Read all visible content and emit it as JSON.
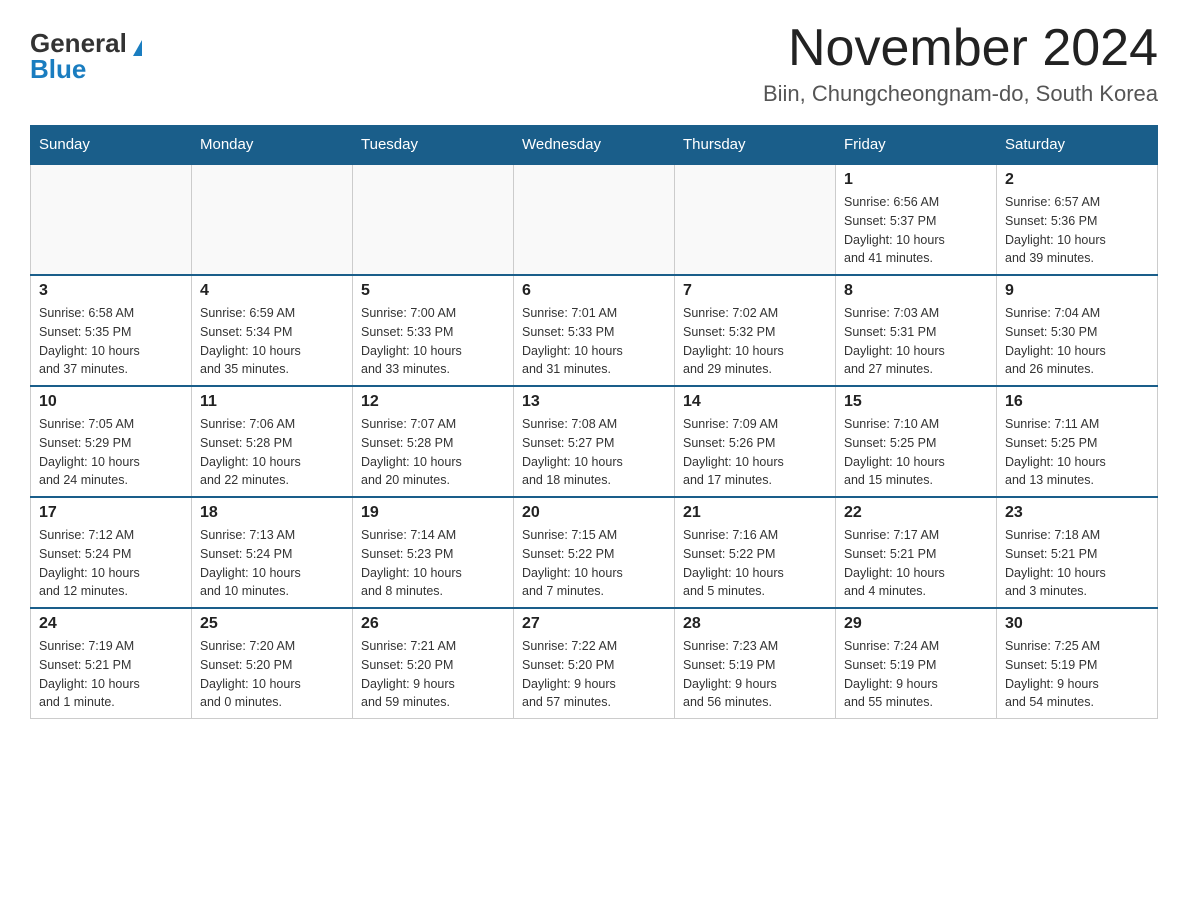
{
  "logo": {
    "general": "General",
    "blue": "Blue"
  },
  "title": "November 2024",
  "subtitle": "Biin, Chungcheongnam-do, South Korea",
  "weekdays": [
    "Sunday",
    "Monday",
    "Tuesday",
    "Wednesday",
    "Thursday",
    "Friday",
    "Saturday"
  ],
  "weeks": [
    [
      {
        "day": "",
        "info": ""
      },
      {
        "day": "",
        "info": ""
      },
      {
        "day": "",
        "info": ""
      },
      {
        "day": "",
        "info": ""
      },
      {
        "day": "",
        "info": ""
      },
      {
        "day": "1",
        "info": "Sunrise: 6:56 AM\nSunset: 5:37 PM\nDaylight: 10 hours\nand 41 minutes."
      },
      {
        "day": "2",
        "info": "Sunrise: 6:57 AM\nSunset: 5:36 PM\nDaylight: 10 hours\nand 39 minutes."
      }
    ],
    [
      {
        "day": "3",
        "info": "Sunrise: 6:58 AM\nSunset: 5:35 PM\nDaylight: 10 hours\nand 37 minutes."
      },
      {
        "day": "4",
        "info": "Sunrise: 6:59 AM\nSunset: 5:34 PM\nDaylight: 10 hours\nand 35 minutes."
      },
      {
        "day": "5",
        "info": "Sunrise: 7:00 AM\nSunset: 5:33 PM\nDaylight: 10 hours\nand 33 minutes."
      },
      {
        "day": "6",
        "info": "Sunrise: 7:01 AM\nSunset: 5:33 PM\nDaylight: 10 hours\nand 31 minutes."
      },
      {
        "day": "7",
        "info": "Sunrise: 7:02 AM\nSunset: 5:32 PM\nDaylight: 10 hours\nand 29 minutes."
      },
      {
        "day": "8",
        "info": "Sunrise: 7:03 AM\nSunset: 5:31 PM\nDaylight: 10 hours\nand 27 minutes."
      },
      {
        "day": "9",
        "info": "Sunrise: 7:04 AM\nSunset: 5:30 PM\nDaylight: 10 hours\nand 26 minutes."
      }
    ],
    [
      {
        "day": "10",
        "info": "Sunrise: 7:05 AM\nSunset: 5:29 PM\nDaylight: 10 hours\nand 24 minutes."
      },
      {
        "day": "11",
        "info": "Sunrise: 7:06 AM\nSunset: 5:28 PM\nDaylight: 10 hours\nand 22 minutes."
      },
      {
        "day": "12",
        "info": "Sunrise: 7:07 AM\nSunset: 5:28 PM\nDaylight: 10 hours\nand 20 minutes."
      },
      {
        "day": "13",
        "info": "Sunrise: 7:08 AM\nSunset: 5:27 PM\nDaylight: 10 hours\nand 18 minutes."
      },
      {
        "day": "14",
        "info": "Sunrise: 7:09 AM\nSunset: 5:26 PM\nDaylight: 10 hours\nand 17 minutes."
      },
      {
        "day": "15",
        "info": "Sunrise: 7:10 AM\nSunset: 5:25 PM\nDaylight: 10 hours\nand 15 minutes."
      },
      {
        "day": "16",
        "info": "Sunrise: 7:11 AM\nSunset: 5:25 PM\nDaylight: 10 hours\nand 13 minutes."
      }
    ],
    [
      {
        "day": "17",
        "info": "Sunrise: 7:12 AM\nSunset: 5:24 PM\nDaylight: 10 hours\nand 12 minutes."
      },
      {
        "day": "18",
        "info": "Sunrise: 7:13 AM\nSunset: 5:24 PM\nDaylight: 10 hours\nand 10 minutes."
      },
      {
        "day": "19",
        "info": "Sunrise: 7:14 AM\nSunset: 5:23 PM\nDaylight: 10 hours\nand 8 minutes."
      },
      {
        "day": "20",
        "info": "Sunrise: 7:15 AM\nSunset: 5:22 PM\nDaylight: 10 hours\nand 7 minutes."
      },
      {
        "day": "21",
        "info": "Sunrise: 7:16 AM\nSunset: 5:22 PM\nDaylight: 10 hours\nand 5 minutes."
      },
      {
        "day": "22",
        "info": "Sunrise: 7:17 AM\nSunset: 5:21 PM\nDaylight: 10 hours\nand 4 minutes."
      },
      {
        "day": "23",
        "info": "Sunrise: 7:18 AM\nSunset: 5:21 PM\nDaylight: 10 hours\nand 3 minutes."
      }
    ],
    [
      {
        "day": "24",
        "info": "Sunrise: 7:19 AM\nSunset: 5:21 PM\nDaylight: 10 hours\nand 1 minute."
      },
      {
        "day": "25",
        "info": "Sunrise: 7:20 AM\nSunset: 5:20 PM\nDaylight: 10 hours\nand 0 minutes."
      },
      {
        "day": "26",
        "info": "Sunrise: 7:21 AM\nSunset: 5:20 PM\nDaylight: 9 hours\nand 59 minutes."
      },
      {
        "day": "27",
        "info": "Sunrise: 7:22 AM\nSunset: 5:20 PM\nDaylight: 9 hours\nand 57 minutes."
      },
      {
        "day": "28",
        "info": "Sunrise: 7:23 AM\nSunset: 5:19 PM\nDaylight: 9 hours\nand 56 minutes."
      },
      {
        "day": "29",
        "info": "Sunrise: 7:24 AM\nSunset: 5:19 PM\nDaylight: 9 hours\nand 55 minutes."
      },
      {
        "day": "30",
        "info": "Sunrise: 7:25 AM\nSunset: 5:19 PM\nDaylight: 9 hours\nand 54 minutes."
      }
    ]
  ]
}
